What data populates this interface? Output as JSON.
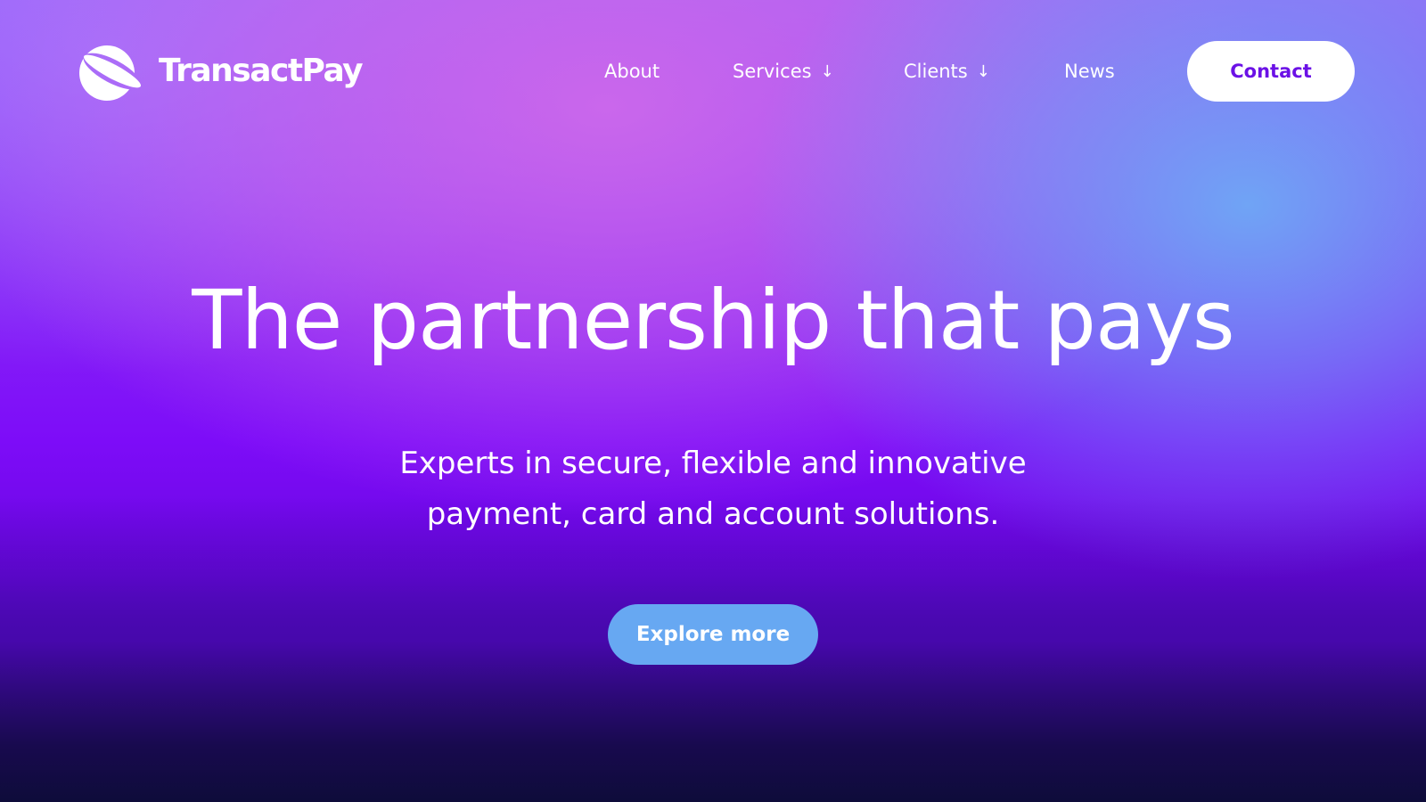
{
  "brand": {
    "name": "TransactPay",
    "logo_icon": "orbit-logo-icon"
  },
  "nav": {
    "items": [
      {
        "label": "About",
        "has_dropdown": false
      },
      {
        "label": "Services",
        "has_dropdown": true,
        "icon": "arrow-down-icon"
      },
      {
        "label": "Clients",
        "has_dropdown": true,
        "icon": "arrow-down-icon"
      },
      {
        "label": "News",
        "has_dropdown": false
      }
    ],
    "dropdown_glyph": "↓",
    "contact_label": "Contact"
  },
  "hero": {
    "title": "The partnership that pays",
    "subtitle_lines": [
      "Experts in secure, flexible and innovative",
      "payment, card and account solutions."
    ],
    "cta_label": "Explore more"
  },
  "colors": {
    "accent_purple": "#6b11e6",
    "cta_blue": "#67a8f2",
    "text": "#ffffff"
  }
}
